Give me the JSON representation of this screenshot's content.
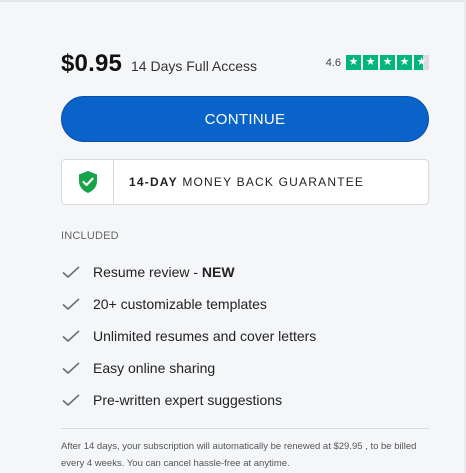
{
  "plan": {
    "price": "$0.95",
    "access_label": "14 Days Full Access",
    "rating_value": "4.6",
    "rating_stars": 4.6
  },
  "cta": {
    "label": "CONTINUE"
  },
  "guarantee": {
    "strong_text": "14-DAY",
    "text": " MONEY BACK GUARANTEE",
    "icon": "shield-check-icon"
  },
  "included": {
    "label": "INCLUDED",
    "items": [
      {
        "text": "Resume review - ",
        "badge": "NEW"
      },
      {
        "text": "20+ customizable templates",
        "badge": ""
      },
      {
        "text": "Unlimited resumes and cover letters",
        "badge": ""
      },
      {
        "text": "Easy online sharing",
        "badge": ""
      },
      {
        "text": "Pre-written expert suggestions",
        "badge": ""
      }
    ]
  },
  "footnote": "After 14 days, your subscription will automatically be renewed at $29.95 , to be billed every 4 weeks. You can cancel hassle-free at anytime.",
  "colors": {
    "primary": "#0a63c9",
    "trustpilot_green": "#00b67a",
    "shield_green": "#16a34a"
  }
}
